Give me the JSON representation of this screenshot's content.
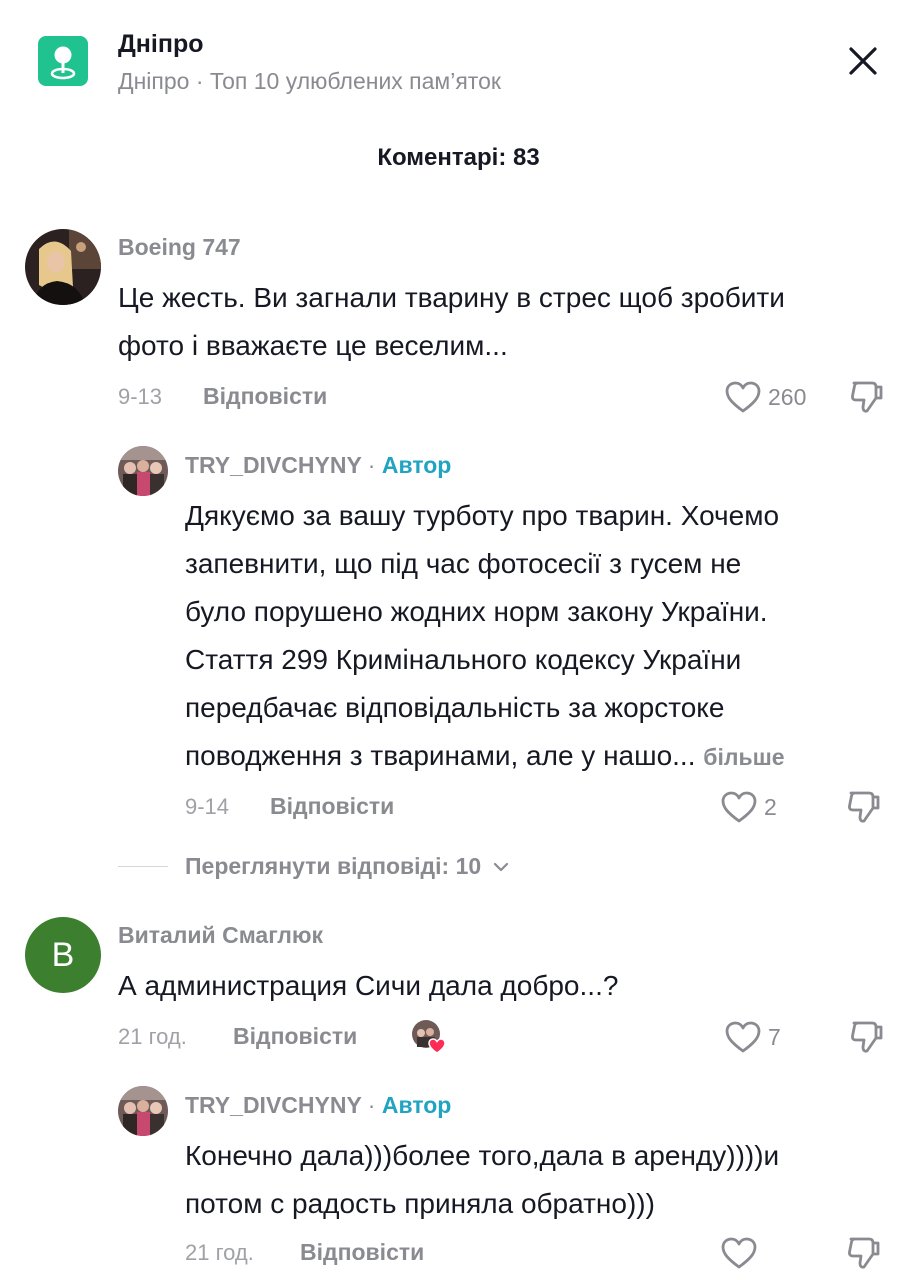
{
  "header": {
    "place_name": "Дніпро",
    "subtitle": "Дніпро · Топ 10 улюблених пам’яток",
    "comments_title": "Коментарі: 83"
  },
  "colors": {
    "accent_green": "#20c28f",
    "author_blue": "#20a4c2",
    "muted_text": "#8a8b91",
    "avatar_letter_bg": "#3b7f2f",
    "liked_heart": "#fe2c55"
  },
  "comments": [
    {
      "username": "Boeing 747",
      "text_lines": [
        "Це жесть. Ви загнали тварину в стрес щоб зробити",
        "фото і вважаєте це веселим..."
      ],
      "time": "9-13",
      "reply_label": "Відповісти",
      "likes": "260",
      "reply": {
        "username": "TRY_DIVCHYNY",
        "badge": "Автор",
        "separator": "·",
        "text_lines": [
          "Дякуємо за вашу турботу про тварин. Хочемо",
          "запевнити, що під час фотосесії з гусем не",
          "було порушено жодних норм закону України.",
          "Стаття 299 Кримінального кодексу України",
          "передбачає відповідальність за жорстоке",
          "поводження з тваринами, але у нашо..."
        ],
        "more_label": "більше",
        "time": "9-14",
        "reply_label": "Відповісти",
        "likes": "2"
      },
      "view_replies_label": "Переглянути відповіді: 10"
    },
    {
      "username": "Виталий Смаглюк",
      "avatar_letter": "B",
      "text_lines": [
        "А администрация Сичи дала добро...?"
      ],
      "time": "21 год.",
      "reply_label": "Відповісти",
      "likes": "7",
      "reply": {
        "username": "TRY_DIVCHYNY",
        "badge": "Автор",
        "separator": "·",
        "text_lines": [
          "Конечно дала)))более того,дала в аренду))))и",
          "потом с радость приняла обратно)))"
        ],
        "time": "21 год.",
        "reply_label": "Відповісти",
        "likes": ""
      }
    }
  ]
}
